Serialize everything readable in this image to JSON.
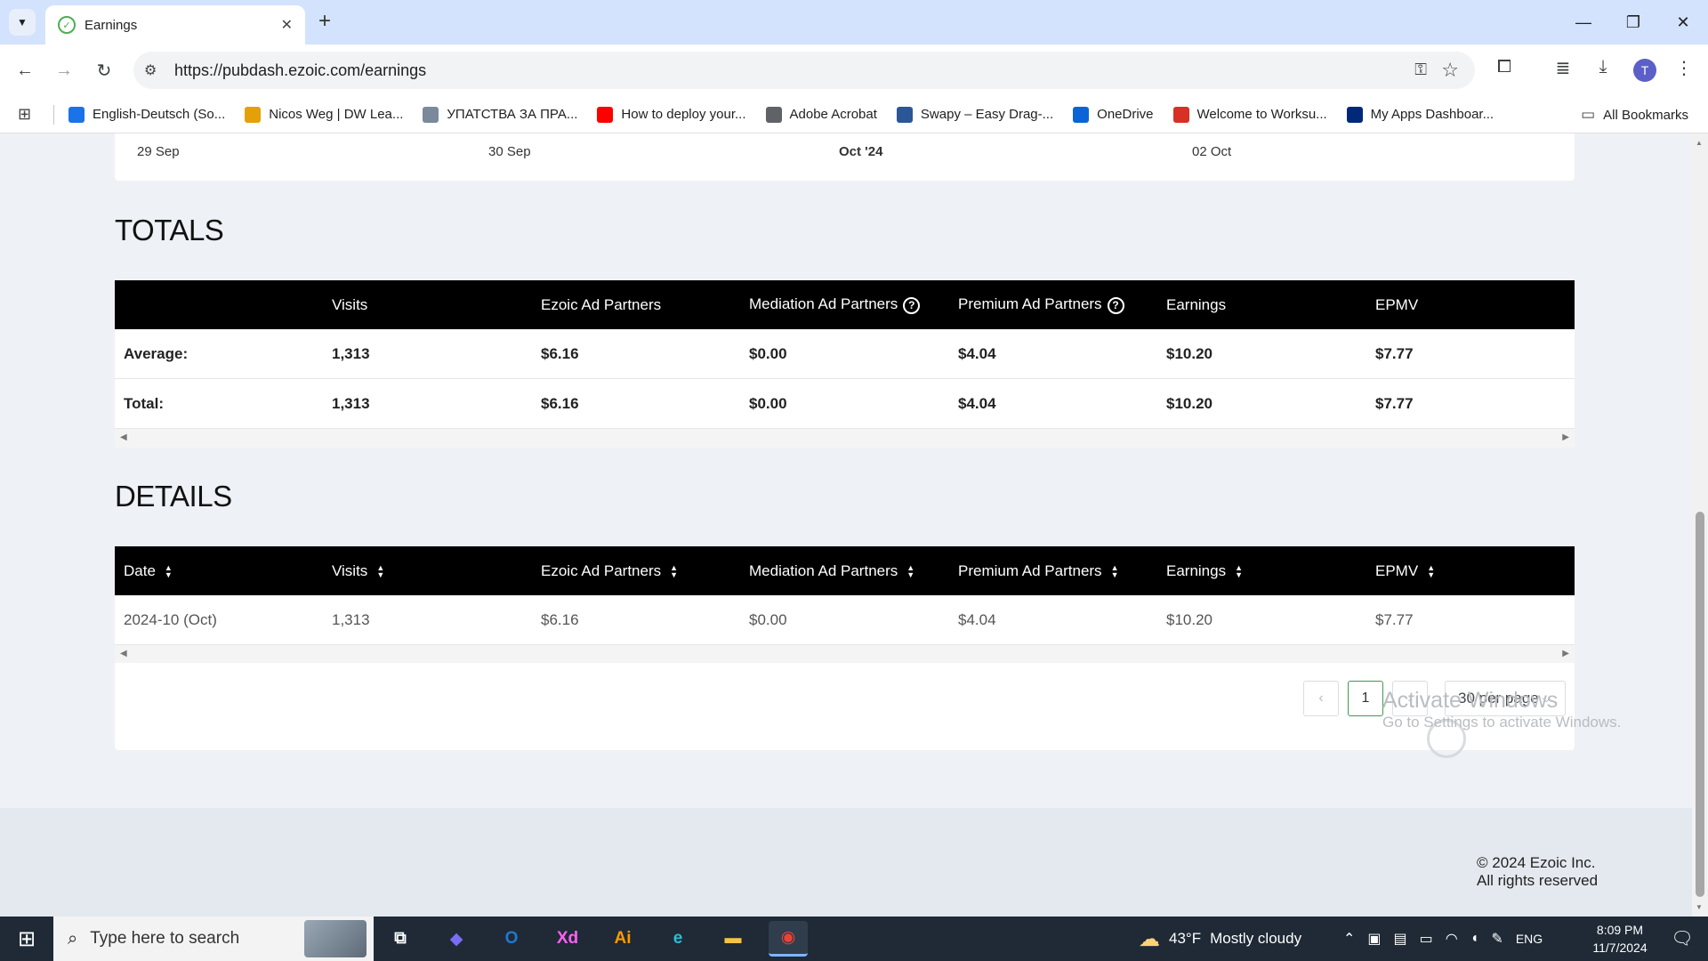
{
  "browser": {
    "tab_title": "Earnings",
    "tab_close": "✕",
    "new_tab": "+",
    "url": "https://pubdash.ezoic.com/earnings",
    "avatar_letter": "T",
    "window_buttons": [
      "—",
      "❐",
      "✕"
    ],
    "bookmarks": [
      {
        "label": "English-Deutsch (So...",
        "icon": "translate-star-icon",
        "color": "#1a73e8"
      },
      {
        "label": "Nicos Weg | DW Lea...",
        "icon": "dw-icon",
        "color": "#e3a008"
      },
      {
        "label": "УПАТСТВА ЗА ПРА...",
        "icon": "plane-icon",
        "color": "#7a8a9a"
      },
      {
        "label": "How to deploy your...",
        "icon": "youtube-icon",
        "color": "#ff0000"
      },
      {
        "label": "Adobe Acrobat",
        "icon": "globe-icon",
        "color": "#5f6368"
      },
      {
        "label": "Swapy – Easy Drag-...",
        "icon": "swapy-icon",
        "color": "#2b5797"
      },
      {
        "label": "OneDrive",
        "icon": "onedrive-icon",
        "color": "#0a64d6"
      },
      {
        "label": "Welcome to Worksu...",
        "icon": "gmail-icon",
        "color": "#d93025"
      },
      {
        "label": "My Apps Dashboar...",
        "icon": "okta-icon",
        "color": "#00297a"
      }
    ],
    "all_bookmarks": "All Bookmarks"
  },
  "chart_axis": {
    "ticks": [
      {
        "label": "29 Sep",
        "bold": false
      },
      {
        "label": "30 Sep",
        "bold": false
      },
      {
        "label": "Oct '24",
        "bold": true
      },
      {
        "label": "02 Oct",
        "bold": false
      }
    ]
  },
  "totals": {
    "title": "TOTALS",
    "columns": [
      "",
      "Visits",
      "Ezoic Ad Partners",
      "Mediation Ad Partners",
      "Premium Ad Partners",
      "Earnings",
      "EPMV"
    ],
    "help_icon_columns": [
      "Mediation Ad Partners",
      "Premium Ad Partners"
    ],
    "rows": [
      [
        "Average:",
        "1,313",
        "$6.16",
        "$0.00",
        "$4.04",
        "$10.20",
        "$7.77"
      ],
      [
        "Total:",
        "1,313",
        "$6.16",
        "$0.00",
        "$4.04",
        "$10.20",
        "$7.77"
      ]
    ]
  },
  "details": {
    "title": "DETAILS",
    "columns": [
      "Date",
      "Visits",
      "Ezoic Ad Partners",
      "Mediation Ad Partners",
      "Premium Ad Partners",
      "Earnings",
      "EPMV"
    ],
    "rows": [
      [
        "2024-10 (Oct)",
        "1,313",
        "$6.16",
        "$0.00",
        "$4.04",
        "$10.20",
        "$7.77"
      ]
    ]
  },
  "pagination": {
    "prev": "‹",
    "current_page": "1",
    "next": "›",
    "per_page": "30 per page"
  },
  "footer": {
    "copyright": "© 2024 Ezoic Inc.",
    "rights": "All rights reserved"
  },
  "watermark": {
    "title": "Activate Windows",
    "subtitle": "Go to Settings to activate Windows."
  },
  "taskbar": {
    "search_placeholder": "Type here to search",
    "weather_temp": "43°F",
    "weather_text": "Mostly cloudy",
    "language": "ENG",
    "time": "8:09 PM",
    "date": "11/7/2024",
    "apps": [
      {
        "name": "task-view",
        "glyph": "⧉",
        "color": "#ffffff"
      },
      {
        "name": "copilot",
        "glyph": "◆",
        "color": "#7b6cf6"
      },
      {
        "name": "outlook",
        "glyph": "O",
        "color": "#1f78d1"
      },
      {
        "name": "adobe-xd",
        "glyph": "Xd",
        "color": "#ff61f6"
      },
      {
        "name": "adobe-illustrator",
        "glyph": "Ai",
        "color": "#ff9a00"
      },
      {
        "name": "edge",
        "glyph": "e",
        "color": "#2ebdd8"
      },
      {
        "name": "file-explorer",
        "glyph": "▬",
        "color": "#f4c542"
      },
      {
        "name": "chrome",
        "glyph": "◉",
        "color": "#ea4335"
      }
    ]
  }
}
